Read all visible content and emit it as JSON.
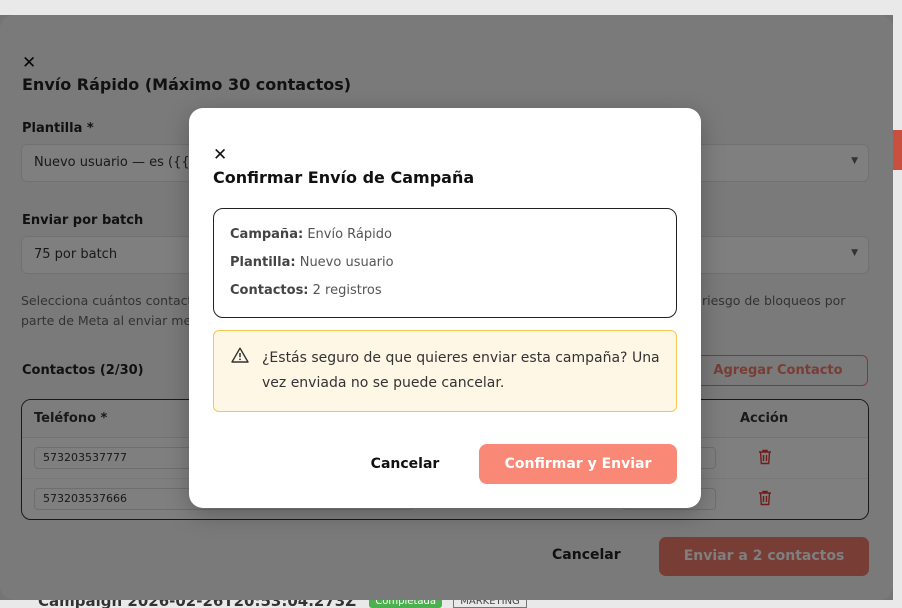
{
  "background": {
    "campaign_row": "Campaign 2026-02-26T20:53:04.273Z",
    "status_badge": "Completada",
    "category_badge": "MARKETING"
  },
  "quick_send_modal": {
    "title": "Envío Rápido (Máximo 30 contactos)",
    "template_label": "Plantilla *",
    "template_value": "Nuevo usuario — es ({{1}}",
    "batch_label": "Enviar por batch",
    "batch_value": "75 por batch",
    "help_text_left_1": "Selecciona cuántos contact",
    "help_text_left_2": "parte de Meta al enviar mer",
    "help_text_right": "riesgo de bloqueos por",
    "contacts_label": "Contactos (2/30)",
    "add_contact_label": "Agregar Contacto",
    "columns": [
      "Teléfono *",
      "Acción"
    ],
    "rows": [
      {
        "phone": "573203537777"
      },
      {
        "phone": "573203537666"
      }
    ],
    "cancel_label": "Cancelar",
    "send_label": "Enviar a 2 contactos"
  },
  "confirm_dialog": {
    "title": "Confirmar Envío de Campaña",
    "summary": {
      "campaign_key": "Campaña:",
      "campaign_value": "Envío Rápido",
      "template_key": "Plantilla:",
      "template_value": "Nuevo usuario",
      "contacts_key": "Contactos:",
      "contacts_value": "2 registros"
    },
    "warning": "¿Estás seguro de que quieres enviar esta campaña? Una vez enviada no se puede cancelar.",
    "cancel_label": "Cancelar",
    "confirm_label": "Confirmar y Enviar"
  },
  "colors": {
    "accent": "#f98876",
    "warning_bg": "#fff7e6",
    "warning_border": "#f5c84d",
    "danger": "#e53935"
  }
}
